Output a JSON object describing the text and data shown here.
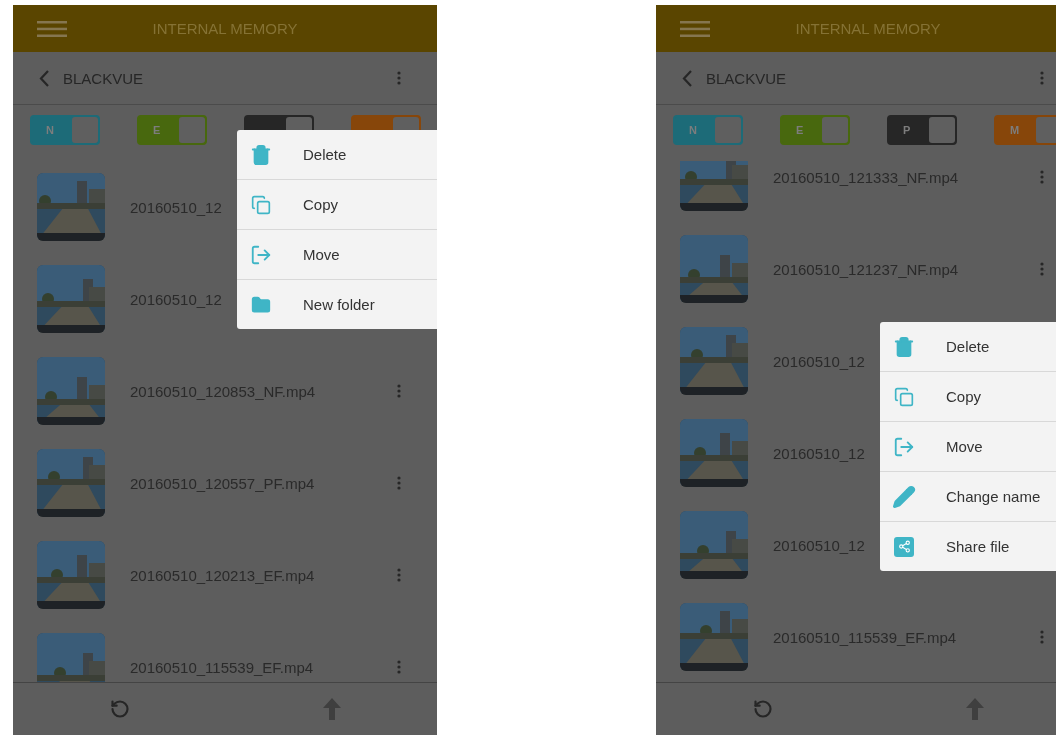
{
  "phones": [
    {
      "header": {
        "title": "INTERNAL MEMORY"
      },
      "folder": {
        "title": "BLACKVUE"
      },
      "filters": [
        {
          "label": "N",
          "color": "#1d6b78"
        },
        {
          "label": "E",
          "color": "#48680e"
        },
        {
          "color": "#262626"
        },
        {
          "color": "#87460a"
        }
      ],
      "files": [
        {
          "name": "20160510_12",
          "more": false
        },
        {
          "name": "20160510_12",
          "more": false
        },
        {
          "name": "20160510_120853_NF.mp4",
          "more": true
        },
        {
          "name": "20160510_120557_PF.mp4",
          "more": true
        },
        {
          "name": "20160510_120213_EF.mp4",
          "more": true
        },
        {
          "name": "20160510_115539_EF.mp4",
          "more": true
        }
      ],
      "menu": {
        "items": [
          {
            "kind": "delete",
            "label": "Delete"
          },
          {
            "kind": "copy",
            "label": "Copy"
          },
          {
            "kind": "move",
            "label": "Move"
          },
          {
            "kind": "folder",
            "label": "New folder"
          }
        ]
      }
    },
    {
      "header": {
        "title": "INTERNAL MEMORY"
      },
      "folder": {
        "title": "BLACKVUE"
      },
      "filters": [
        {
          "label": "N",
          "color": "#1d6b78"
        },
        {
          "label": "E",
          "color": "#48680e"
        },
        {
          "label": "P",
          "color": "#262626"
        },
        {
          "label": "M",
          "color": "#87460a"
        }
      ],
      "files": [
        {
          "name": "20160510_121333_NF.mp4",
          "more": true
        },
        {
          "name": "20160510_121237_NF.mp4",
          "more": true
        },
        {
          "name": "20160510_12",
          "more": false
        },
        {
          "name": "20160510_12",
          "more": false
        },
        {
          "name": "20160510_12",
          "more": false
        },
        {
          "name": "20160510_115539_EF.mp4",
          "more": true
        }
      ],
      "menu": {
        "items": [
          {
            "kind": "delete",
            "label": "Delete"
          },
          {
            "kind": "copy",
            "label": "Copy"
          },
          {
            "kind": "move",
            "label": "Move"
          },
          {
            "kind": "rename",
            "label": "Change name"
          },
          {
            "kind": "share",
            "label": "Share file"
          }
        ]
      }
    }
  ]
}
